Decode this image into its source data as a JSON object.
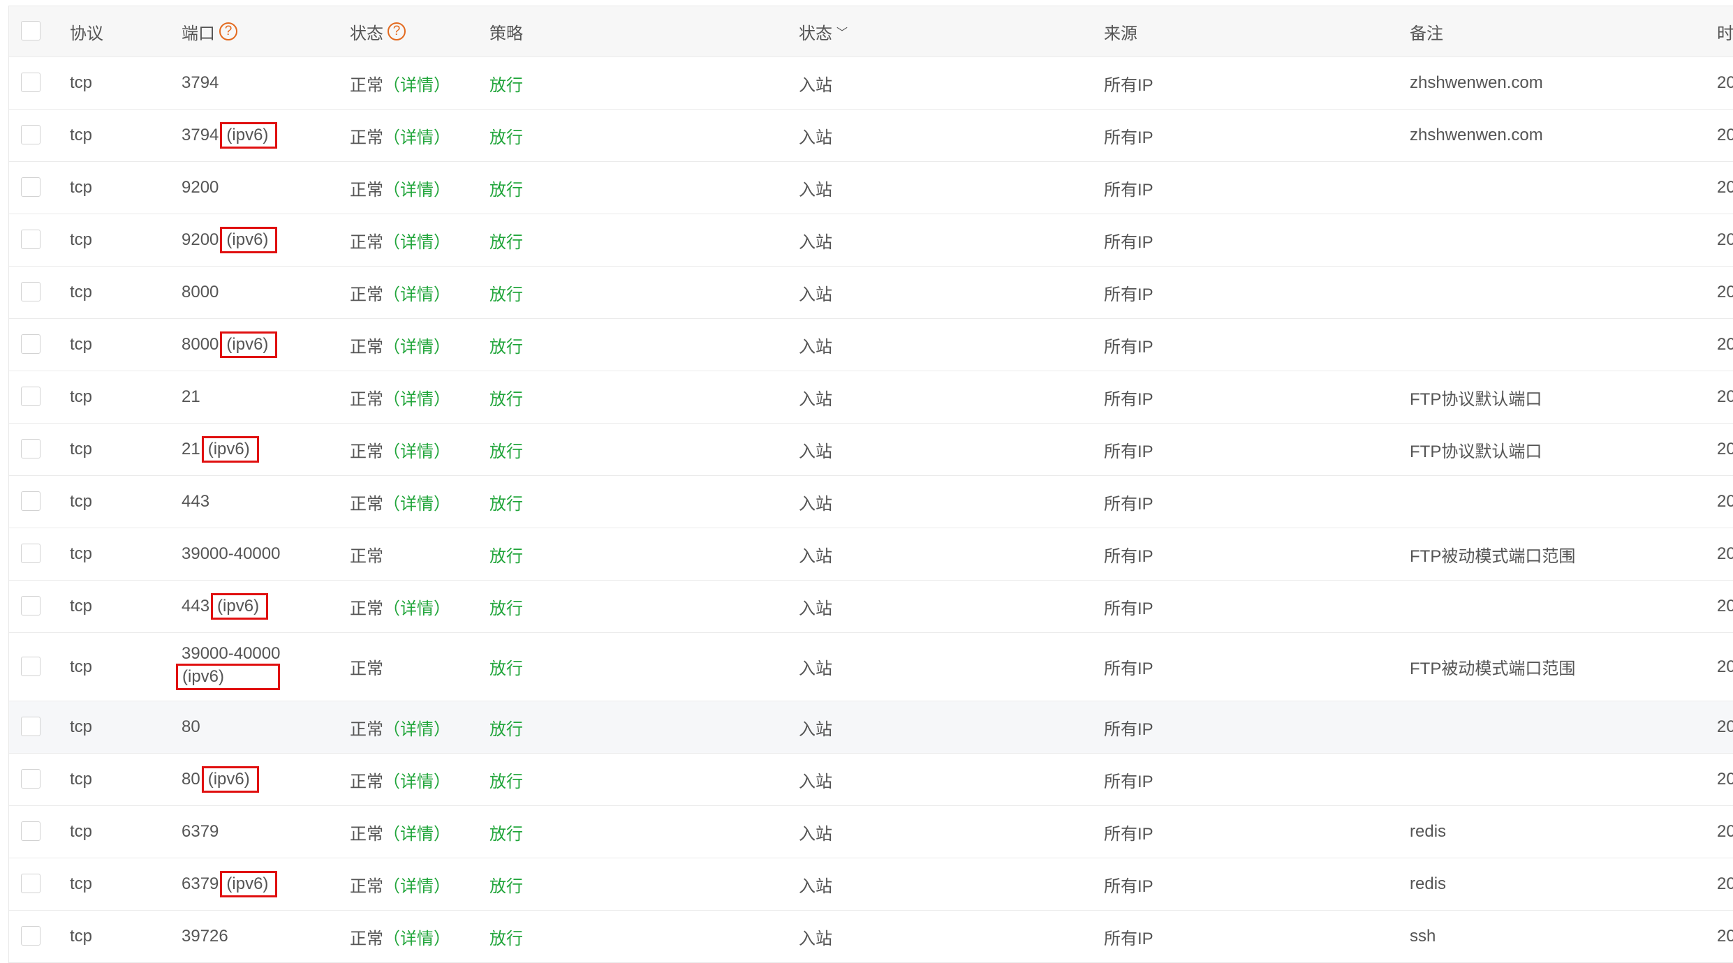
{
  "header": {
    "protocol": "协议",
    "port": "端口",
    "status": "状态",
    "policy": "策略",
    "direction": "状态",
    "source": "来源",
    "note": "备注",
    "time": "时",
    "help_icon_glyph": "?",
    "sort_icon_glyph": "﹀"
  },
  "rows": [
    {
      "protocol": "tcp",
      "port": "3794",
      "ipv6": "",
      "status": "正常",
      "detail": "（详情）",
      "policy": "放行",
      "direction": "入站",
      "source": "所有IP",
      "note": "zhshwenwen.com",
      "time": "20"
    },
    {
      "protocol": "tcp",
      "port": "3794",
      "ipv6": "(ipv6)",
      "status": "正常",
      "detail": "（详情）",
      "policy": "放行",
      "direction": "入站",
      "source": "所有IP",
      "note": "zhshwenwen.com",
      "time": "20"
    },
    {
      "protocol": "tcp",
      "port": "9200",
      "ipv6": "",
      "status": "正常",
      "detail": "（详情）",
      "policy": "放行",
      "direction": "入站",
      "source": "所有IP",
      "note": "",
      "time": "20"
    },
    {
      "protocol": "tcp",
      "port": "9200",
      "ipv6": "(ipv6)",
      "status": "正常",
      "detail": "（详情）",
      "policy": "放行",
      "direction": "入站",
      "source": "所有IP",
      "note": "",
      "time": "20"
    },
    {
      "protocol": "tcp",
      "port": "8000",
      "ipv6": "",
      "status": "正常",
      "detail": "（详情）",
      "policy": "放行",
      "direction": "入站",
      "source": "所有IP",
      "note": "",
      "time": "20"
    },
    {
      "protocol": "tcp",
      "port": "8000",
      "ipv6": "(ipv6)",
      "status": "正常",
      "detail": "（详情）",
      "policy": "放行",
      "direction": "入站",
      "source": "所有IP",
      "note": "",
      "time": "20"
    },
    {
      "protocol": "tcp",
      "port": "21",
      "ipv6": "",
      "status": "正常",
      "detail": "（详情）",
      "policy": "放行",
      "direction": "入站",
      "source": "所有IP",
      "note": "FTP协议默认端口",
      "time": "20"
    },
    {
      "protocol": "tcp",
      "port": "21",
      "ipv6": "(ipv6)",
      "status": "正常",
      "detail": "（详情）",
      "policy": "放行",
      "direction": "入站",
      "source": "所有IP",
      "note": "FTP协议默认端口",
      "time": "20"
    },
    {
      "protocol": "tcp",
      "port": "443",
      "ipv6": "",
      "status": "正常",
      "detail": "（详情）",
      "policy": "放行",
      "direction": "入站",
      "source": "所有IP",
      "note": "",
      "time": "20"
    },
    {
      "protocol": "tcp",
      "port": "39000-40000",
      "ipv6": "",
      "status": "正常",
      "detail": "",
      "policy": "放行",
      "direction": "入站",
      "source": "所有IP",
      "note": "FTP被动模式端口范围",
      "time": "20"
    },
    {
      "protocol": "tcp",
      "port": "443",
      "ipv6": "(ipv6)",
      "status": "正常",
      "detail": "（详情）",
      "policy": "放行",
      "direction": "入站",
      "source": "所有IP",
      "note": "",
      "time": "20"
    },
    {
      "protocol": "tcp",
      "port": "39000-40000",
      "ipv6": "(ipv6)",
      "status": "正常",
      "detail": "",
      "policy": "放行",
      "direction": "入站",
      "source": "所有IP",
      "note": "FTP被动模式端口范围",
      "time": "20"
    },
    {
      "protocol": "tcp",
      "port": "80",
      "ipv6": "",
      "status": "正常",
      "detail": "（详情）",
      "policy": "放行",
      "direction": "入站",
      "source": "所有IP",
      "note": "",
      "time": "20"
    },
    {
      "protocol": "tcp",
      "port": "80",
      "ipv6": "(ipv6)",
      "status": "正常",
      "detail": "（详情）",
      "policy": "放行",
      "direction": "入站",
      "source": "所有IP",
      "note": "",
      "time": "20"
    },
    {
      "protocol": "tcp",
      "port": "6379",
      "ipv6": "",
      "status": "正常",
      "detail": "（详情）",
      "policy": "放行",
      "direction": "入站",
      "source": "所有IP",
      "note": "redis",
      "time": "20"
    },
    {
      "protocol": "tcp",
      "port": "6379",
      "ipv6": "(ipv6)",
      "status": "正常",
      "detail": "（详情）",
      "policy": "放行",
      "direction": "入站",
      "source": "所有IP",
      "note": "redis",
      "time": "20"
    },
    {
      "protocol": "tcp",
      "port": "39726",
      "ipv6": "",
      "status": "正常",
      "detail": "（详情）",
      "policy": "放行",
      "direction": "入站",
      "source": "所有IP",
      "note": "ssh",
      "time": "20"
    }
  ],
  "colors": {
    "accent_green": "#20a53a",
    "highlight_red": "#e01010",
    "help_orange": "#e36a1f"
  }
}
